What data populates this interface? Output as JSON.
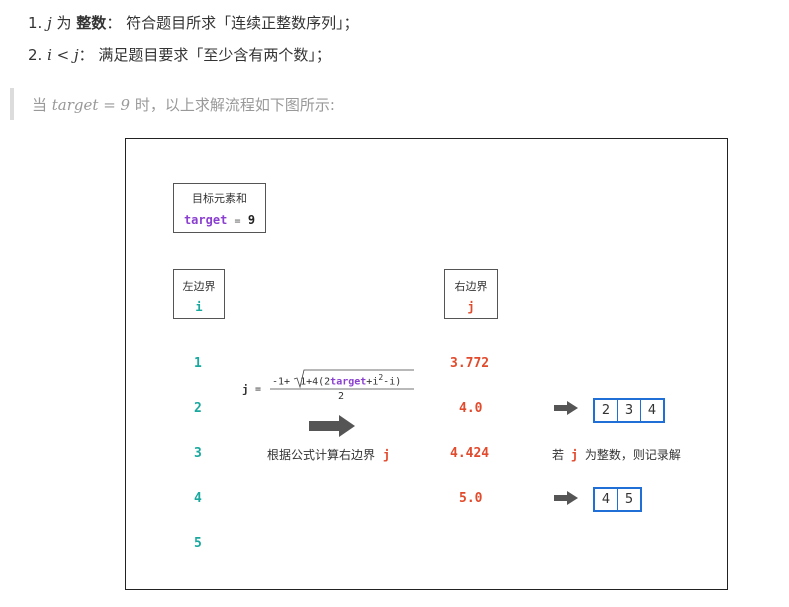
{
  "intro": {
    "line1": {
      "num": "1.",
      "var": "j",
      "pre": " 为 ",
      "bold": "整数",
      "post": "： 符合题目所求「连续正整数序列」；"
    },
    "line2": {
      "num": "2.",
      "expr": "i < j",
      "post": "： 满足题目要求「至少含有两个数」；"
    }
  },
  "note": {
    "pre": "当 ",
    "expr": "target = 9",
    "post": " 时，以上求解流程如下图所示:"
  },
  "diagram": {
    "target_box": {
      "label": "目标元素和",
      "keyword": "target",
      "op": "=",
      "value": "9"
    },
    "left_box": {
      "label": "左边界",
      "var": "i"
    },
    "right_box": {
      "label": "右边界",
      "var": "j"
    },
    "i_values": [
      "1",
      "2",
      "3",
      "4",
      "5"
    ],
    "j_values": [
      "3.772",
      "4.0",
      "4.424",
      "5.0"
    ],
    "formula": {
      "lhs": "j",
      "eq": "=",
      "num_a": "-1+",
      "num_b": "1+4(2",
      "num_c": "target",
      "num_d": "+i",
      "num_e": "2",
      "num_f": "-i)",
      "den": "2"
    },
    "caption_left": {
      "text": "根据公式计算右边界",
      "var": "j"
    },
    "caption_right": {
      "pre": "若",
      "var": "j",
      "post": "为整数，则记录解"
    },
    "solutions": [
      [
        "2",
        "3",
        "4"
      ],
      [
        "4",
        "5"
      ]
    ]
  },
  "colors": {
    "purple": "#8a3fd1",
    "teal": "#19a89e",
    "red": "#e24a2c",
    "blue": "#1f6fd6",
    "arrow": "#555555"
  }
}
